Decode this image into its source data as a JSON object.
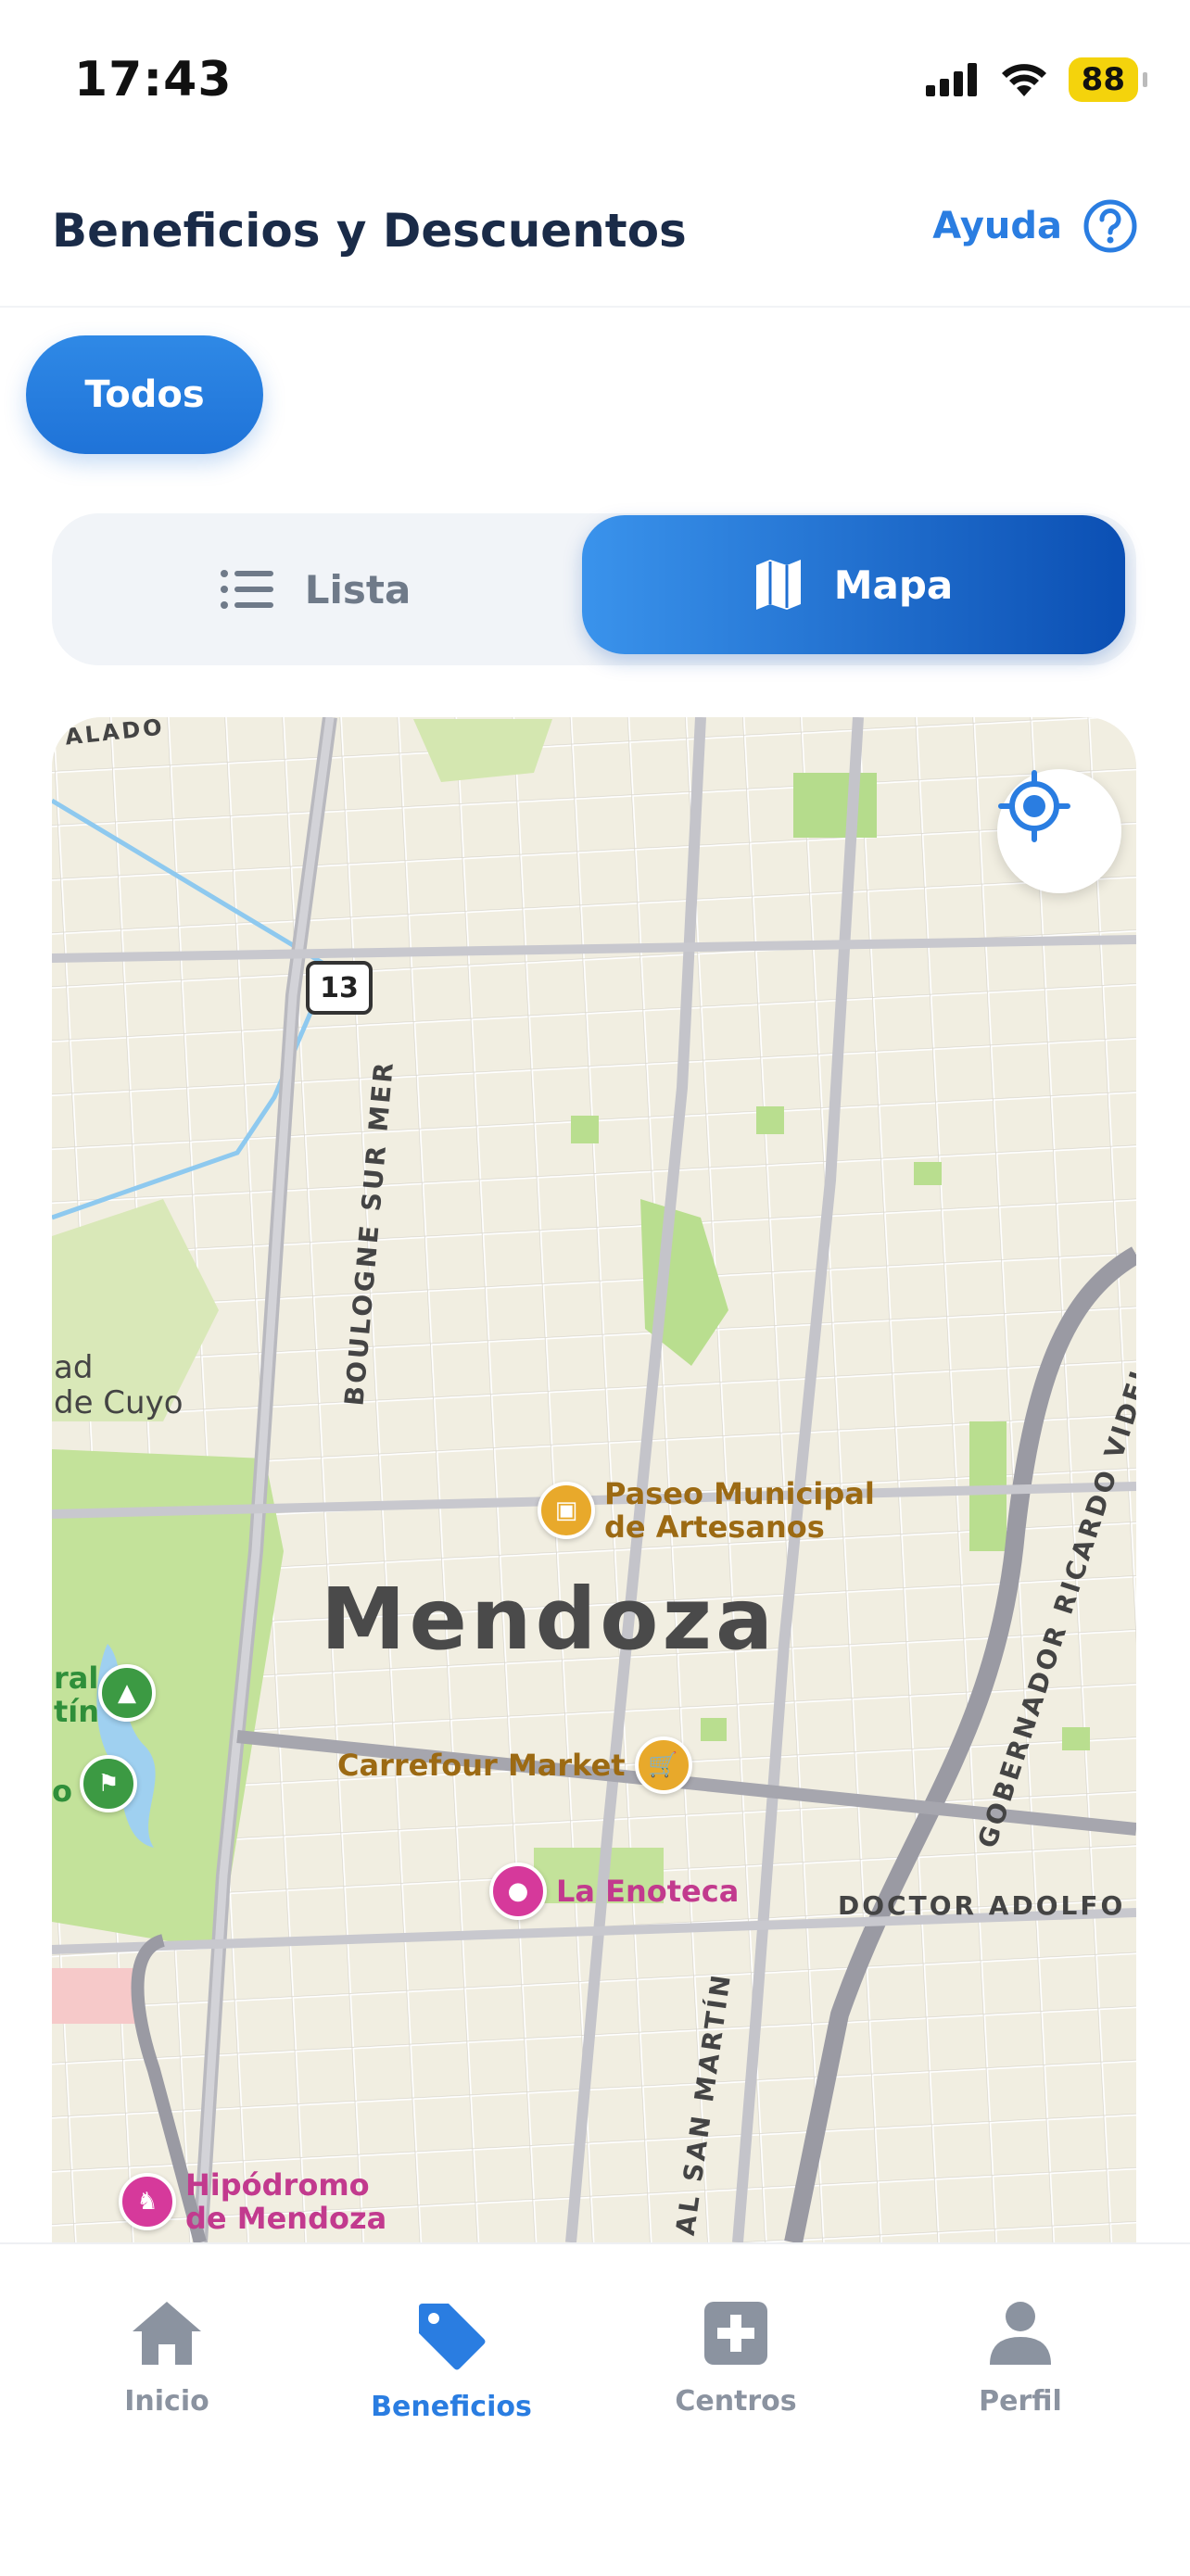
{
  "status_bar": {
    "time": "17:43",
    "battery": "88"
  },
  "header": {
    "title": "Beneficios y Descuentos",
    "help_label": "Ayuda"
  },
  "filters": {
    "chips": [
      "Todos"
    ]
  },
  "view_toggle": {
    "list_label": "Lista",
    "map_label": "Mapa",
    "selected": "Mapa"
  },
  "map": {
    "city_label": "Mendoza",
    "route_shield": "13",
    "road_labels": [
      "BOULOGNE SUR MER",
      "GOBERNADOR RICARDO VIDELA",
      "DOCTOR ADOLFO C",
      "AL SAN MARTÍN",
      "ALADO"
    ],
    "partial_labels": [
      "ad",
      "de Cuyo",
      "ral",
      "tín",
      "o"
    ],
    "pois": [
      {
        "name": "Paseo Municipal de Artesanos",
        "line1": "Paseo Municipal",
        "line2": "de Artesanos",
        "color": "#e8a92b",
        "icon": "briefcase-icon"
      },
      {
        "name": "Carrefour Market",
        "color": "#e8a92b",
        "icon": "cart-icon"
      },
      {
        "name": "La Enoteca",
        "color": "#d6399b",
        "icon": "wine-icon"
      },
      {
        "name": "Hipódromo de Mendoza",
        "line1": "Hipódromo",
        "line2": "de Mendoza",
        "color": "#d6399b",
        "icon": "horse-icon"
      }
    ]
  },
  "bottom_nav": {
    "items": [
      {
        "label": "Inicio",
        "icon": "home-icon"
      },
      {
        "label": "Beneficios",
        "icon": "tag-icon",
        "active": true
      },
      {
        "label": "Centros",
        "icon": "medical-cross-icon"
      },
      {
        "label": "Perfil",
        "icon": "person-icon"
      }
    ]
  },
  "colors": {
    "accent": "#2a7de1",
    "title": "#1a2b48",
    "map_bg": "#f1eee1",
    "park": "#c3e29a"
  }
}
